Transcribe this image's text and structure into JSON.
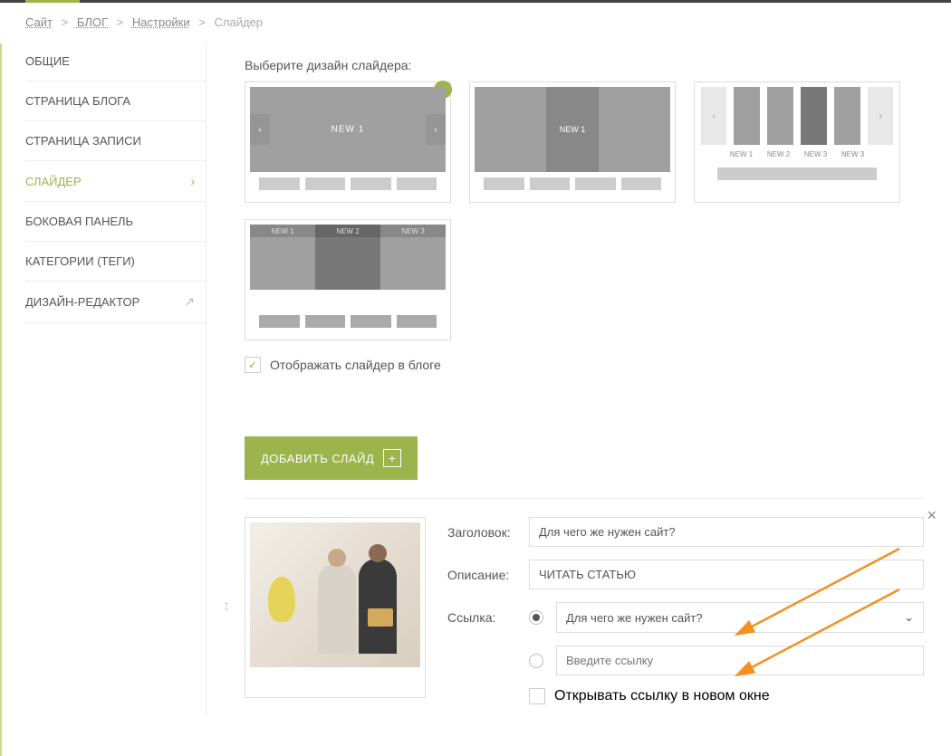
{
  "breadcrumb": {
    "site": "Сайт",
    "blog": "БЛОГ",
    "settings": "Настройки",
    "current": "Слайдер"
  },
  "sidebar": {
    "items": [
      {
        "label": "ОБЩИЕ"
      },
      {
        "label": "СТРАНИЦА БЛОГА"
      },
      {
        "label": "СТРАНИЦА ЗАПИСИ"
      },
      {
        "label": "СЛАЙДЕР"
      },
      {
        "label": "БОКОВАЯ ПАНЕЛЬ"
      },
      {
        "label": "КАТЕГОРИИ (ТЕГИ)"
      },
      {
        "label": "ДИЗАЙН-РЕДАКТОР"
      }
    ]
  },
  "content": {
    "choose_design": "Выберите дизайн слайдера:",
    "design1_label": "NEW 1",
    "design2_label": "NEW 1",
    "design3_labels": [
      "NEW 1",
      "NEW 2",
      "NEW 3",
      "NEW 3"
    ],
    "design4_labels": [
      "NEW 1",
      "NEW 2",
      "NEW 3"
    ],
    "show_slider_checkbox": "Отображать слайдер в блоге",
    "add_slide_btn": "ДОБАВИТЬ СЛАЙД"
  },
  "editor": {
    "title_label": "Заголовок:",
    "title_value": "Для чего же нужен сайт?",
    "desc_label": "Описание:",
    "desc_value": "ЧИТАТЬ СТАТЬЮ",
    "link_label": "Ссылка:",
    "link_dropdown_value": "Для чего же нужен сайт?",
    "link_input_placeholder": "Введите ссылку",
    "open_new_window": "Открывать ссылку в новом окне"
  }
}
